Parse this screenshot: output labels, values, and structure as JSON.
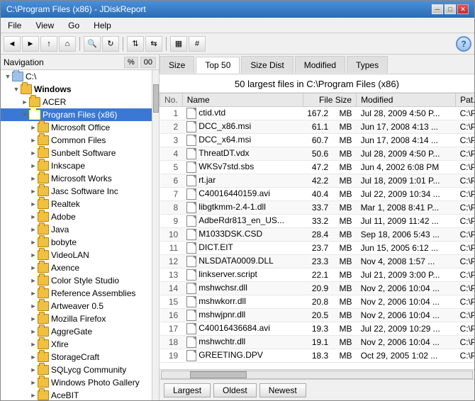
{
  "window": {
    "title": "C:\\Program Files (x86) - JDiskReport",
    "min_label": "─",
    "max_label": "□",
    "close_label": "✕"
  },
  "menu": {
    "items": [
      "File",
      "View",
      "Go",
      "Help"
    ]
  },
  "toolbar": {
    "buttons": [
      "◄",
      "►",
      "↑",
      "⌂",
      "🔍",
      "↻",
      "⇅",
      "⇆",
      "▦",
      "#"
    ],
    "help_label": "?"
  },
  "nav": {
    "title": "Navigation",
    "pct_label": "%",
    "size_label": "00"
  },
  "tree": {
    "items": [
      {
        "label": "C:\\",
        "level": 0,
        "expanded": true,
        "selected": false
      },
      {
        "label": "Windows",
        "level": 1,
        "expanded": true,
        "selected": false,
        "bold": true
      },
      {
        "label": "ACER",
        "level": 2,
        "expanded": false,
        "selected": false
      },
      {
        "label": "Program Files (x86)",
        "level": 2,
        "expanded": true,
        "selected": true
      },
      {
        "label": "Microsoft Office",
        "level": 3,
        "expanded": false,
        "selected": false
      },
      {
        "label": "Common Files",
        "level": 3,
        "expanded": false,
        "selected": false
      },
      {
        "label": "Sunbelt Software",
        "level": 3,
        "expanded": false,
        "selected": false
      },
      {
        "label": "Inkscape",
        "level": 3,
        "expanded": false,
        "selected": false
      },
      {
        "label": "Microsoft Works",
        "level": 3,
        "expanded": false,
        "selected": false
      },
      {
        "label": "Jasc Software Inc",
        "level": 3,
        "expanded": false,
        "selected": false
      },
      {
        "label": "Realtek",
        "level": 3,
        "expanded": false,
        "selected": false
      },
      {
        "label": "Adobe",
        "level": 3,
        "expanded": false,
        "selected": false
      },
      {
        "label": "Java",
        "level": 3,
        "expanded": false,
        "selected": false
      },
      {
        "label": "bobyte",
        "level": 3,
        "expanded": false,
        "selected": false
      },
      {
        "label": "VideoLAN",
        "level": 3,
        "expanded": false,
        "selected": false
      },
      {
        "label": "Axence",
        "level": 3,
        "expanded": false,
        "selected": false
      },
      {
        "label": "Color Style Studio",
        "level": 3,
        "expanded": false,
        "selected": false
      },
      {
        "label": "Reference Assemblies",
        "level": 3,
        "expanded": false,
        "selected": false
      },
      {
        "label": "Artweaver 0.5",
        "level": 3,
        "expanded": false,
        "selected": false
      },
      {
        "label": "Mozilla Firefox",
        "level": 3,
        "expanded": false,
        "selected": false
      },
      {
        "label": "AggreGate",
        "level": 3,
        "expanded": false,
        "selected": false
      },
      {
        "label": "Xfire",
        "level": 3,
        "expanded": false,
        "selected": false
      },
      {
        "label": "StorageCraft",
        "level": 3,
        "expanded": false,
        "selected": false
      },
      {
        "label": "SQLycg Community",
        "level": 3,
        "expanded": false,
        "selected": false
      },
      {
        "label": "Windows Photo Gallery",
        "level": 3,
        "expanded": false,
        "selected": false
      },
      {
        "label": "AceBIT",
        "level": 3,
        "expanded": false,
        "selected": false
      }
    ]
  },
  "tabs": {
    "items": [
      "Size",
      "Top 50",
      "Size Dist",
      "Modified",
      "Types"
    ],
    "active": "Top 50"
  },
  "content": {
    "title": "50 largest files in C:\\Program Files (x86)",
    "columns": [
      "No.",
      "Name",
      "File Size",
      "Modified",
      "Pat..."
    ],
    "rows": [
      {
        "no": "1",
        "name": "ctid.vtd",
        "size": "167.2",
        "unit": "MB",
        "modified": "Jul 28, 2009 4:50 P...",
        "path": "C:\\P..."
      },
      {
        "no": "2",
        "name": "DCC_x86.msi",
        "size": "61.1",
        "unit": "MB",
        "modified": "Jun 17, 2008 4:13 ...",
        "path": "C:\\P..."
      },
      {
        "no": "3",
        "name": "DCC_x64.msi",
        "size": "60.7",
        "unit": "MB",
        "modified": "Jun 17, 2008 4:14 ...",
        "path": "C:\\P..."
      },
      {
        "no": "4",
        "name": "ThreatDT.vdx",
        "size": "50.6",
        "unit": "MB",
        "modified": "Jul 28, 2009 4:50 P...",
        "path": "C:\\P..."
      },
      {
        "no": "5",
        "name": "WKSv7std.sbs",
        "size": "47.2",
        "unit": "MB",
        "modified": "Jun 4, 2002 6:08 PM",
        "path": "C:\\P..."
      },
      {
        "no": "6",
        "name": "rt.jar",
        "size": "42.2",
        "unit": "MB",
        "modified": "Jul 18, 2009 1:01 P...",
        "path": "C:\\P..."
      },
      {
        "no": "7",
        "name": "C40016440159.avi",
        "size": "40.4",
        "unit": "MB",
        "modified": "Jul 22, 2009 10:34 ...",
        "path": "C:\\P..."
      },
      {
        "no": "8",
        "name": "libgtkmm-2.4-1.dll",
        "size": "33.7",
        "unit": "MB",
        "modified": "Mar 1, 2008 8:41 P...",
        "path": "C:\\P..."
      },
      {
        "no": "9",
        "name": "AdbeRdr813_en_US...",
        "size": "33.2",
        "unit": "MB",
        "modified": "Jul 11, 2009 11:42 ...",
        "path": "C:\\P..."
      },
      {
        "no": "10",
        "name": "M1033DSK.CSD",
        "size": "28.4",
        "unit": "MB",
        "modified": "Sep 18, 2006 5:43 ...",
        "path": "C:\\P..."
      },
      {
        "no": "11",
        "name": "DICT.EIT",
        "size": "23.7",
        "unit": "MB",
        "modified": "Jun 15, 2005 6:12 ...",
        "path": "C:\\P..."
      },
      {
        "no": "12",
        "name": "NLSDATA0009.DLL",
        "size": "23.3",
        "unit": "MB",
        "modified": "Nov 4, 2008 1:57 ...",
        "path": "C:\\P..."
      },
      {
        "no": "13",
        "name": "linkserver.script",
        "size": "22.1",
        "unit": "MB",
        "modified": "Jul 21, 2009 3:00 P...",
        "path": "C:\\P..."
      },
      {
        "no": "14",
        "name": "mshwchsr.dll",
        "size": "20.9",
        "unit": "MB",
        "modified": "Nov 2, 2006 10:04 ...",
        "path": "C:\\P..."
      },
      {
        "no": "15",
        "name": "mshwkorr.dll",
        "size": "20.8",
        "unit": "MB",
        "modified": "Nov 2, 2006 10:04 ...",
        "path": "C:\\P..."
      },
      {
        "no": "16",
        "name": "mshwjpnr.dll",
        "size": "20.5",
        "unit": "MB",
        "modified": "Nov 2, 2006 10:04 ...",
        "path": "C:\\P..."
      },
      {
        "no": "17",
        "name": "C40016436684.avi",
        "size": "19.3",
        "unit": "MB",
        "modified": "Jul 22, 2009 10:29 ...",
        "path": "C:\\P..."
      },
      {
        "no": "18",
        "name": "mshwchtr.dll",
        "size": "19.1",
        "unit": "MB",
        "modified": "Nov 2, 2006 10:04 ...",
        "path": "C:\\P..."
      },
      {
        "no": "19",
        "name": "GREETING.DPV",
        "size": "18.3",
        "unit": "MB",
        "modified": "Oct 29, 2005 1:02 ...",
        "path": "C:\\P..."
      }
    ]
  },
  "bottom_buttons": {
    "largest": "Largest",
    "oldest": "Oldest",
    "newest": "Newest"
  }
}
